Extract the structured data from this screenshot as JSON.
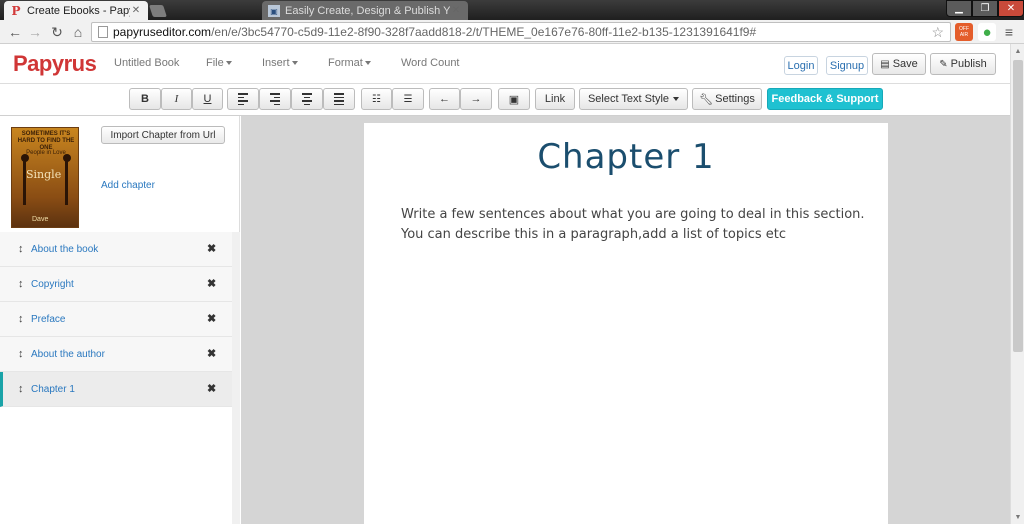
{
  "browser": {
    "active_tab_title": "Create Ebooks - Papyrus E",
    "inactive_tab_title": "Easily Create, Design & Publish Your ...",
    "url_domain": "papyruseditor.com",
    "url_path": "/en/e/3bc54770-c5d9-11e2-8f90-328f7aadd818-2/t/THEME_0e167e76-80ff-11e2-b135-1231391641f9#",
    "ext_label": "OFF AIR"
  },
  "header": {
    "logo": "Papyrus",
    "book_title": "Untitled Book",
    "menu": [
      "File",
      "Insert",
      "Format"
    ],
    "word_count": "Word Count",
    "login": "Login",
    "signup": "Signup",
    "save": "Save",
    "publish": "Publish"
  },
  "toolbar": {
    "bold": "B",
    "italic": "I",
    "underline": "U",
    "link": "Link",
    "text_style": "Select Text Style",
    "settings": "Settings",
    "feedback": "Feedback & Support"
  },
  "sidebar": {
    "import_button": "Import Chapter from Url",
    "add_chapter": "Add chapter",
    "cover": {
      "title_text": "SOMETIMES IT'S HARD TO FIND THE ONE",
      "sub_text": "People in Love",
      "single_text": "Single",
      "author_text": "Dave"
    },
    "chapters": [
      {
        "name": "About the book"
      },
      {
        "name": "Copyright"
      },
      {
        "name": "Preface"
      },
      {
        "name": "About the author"
      },
      {
        "name": "Chapter 1"
      }
    ]
  },
  "editor": {
    "chapter_title": "Chapter 1",
    "body_line1": "Write a few sentences about what you are going to deal in this section.",
    "body_line2": "You can describe this in a paragraph,add a list of topics etc"
  },
  "colors": {
    "brand": "#d03636",
    "feedback": "#1fc1d1",
    "link": "#2a78bf",
    "title": "#1b4e6e"
  }
}
